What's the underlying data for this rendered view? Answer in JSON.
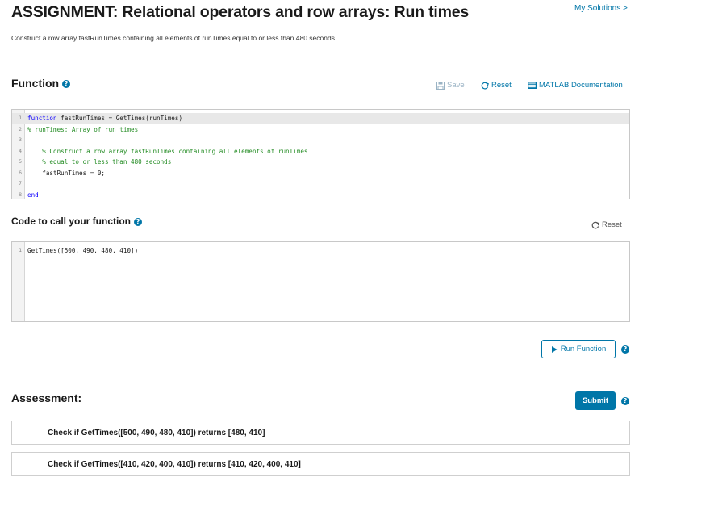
{
  "header": {
    "title": "ASSIGNMENT: Relational operators and row arrays: Run times",
    "my_solutions": "My Solutions >",
    "description": "Construct a row array fastRunTimes containing all elements of runTimes equal to or less than 480 seconds."
  },
  "function_section": {
    "title": "Function",
    "save_label": "Save",
    "reset_label": "Reset",
    "doc_label": "MATLAB Documentation",
    "lines": [
      {
        "num": "1",
        "parts": [
          {
            "t": "function",
            "c": "kw"
          },
          {
            "t": " fastRunTimes = GetTimes(runTimes)",
            "c": "tx"
          }
        ]
      },
      {
        "num": "2",
        "parts": [
          {
            "t": "% runTimes: Array of run times",
            "c": "cm"
          }
        ]
      },
      {
        "num": "3",
        "parts": []
      },
      {
        "num": "4",
        "parts": [
          {
            "t": "    % Construct a row array fastRunTimes containing all elements of runTimes",
            "c": "cm"
          }
        ]
      },
      {
        "num": "5",
        "parts": [
          {
            "t": "    % equal to or less than 480 seconds",
            "c": "cm"
          }
        ]
      },
      {
        "num": "6",
        "parts": [
          {
            "t": "    fastRunTimes = 0;",
            "c": "tx"
          }
        ]
      },
      {
        "num": "7",
        "parts": []
      },
      {
        "num": "8",
        "parts": [
          {
            "t": "end",
            "c": "kw"
          }
        ]
      }
    ]
  },
  "call_section": {
    "title": "Code to call your function",
    "reset_label": "Reset",
    "lines": [
      {
        "num": "1",
        "parts": [
          {
            "t": "GetTimes([500, 490, 480, 410])",
            "c": "tx"
          }
        ]
      }
    ]
  },
  "run_button": {
    "label": "Run Function"
  },
  "assessment": {
    "title": "Assessment:",
    "submit_label": "Submit",
    "tests": [
      "Check if GetTimes([500, 490, 480, 410]) returns [480, 410]",
      "Check if GetTimes([410, 420, 400, 410]) returns [410, 420, 400, 410]"
    ]
  },
  "icons": {
    "help": "help-icon",
    "save": "save-disk-icon",
    "reset": "reset-arrow-icon",
    "doc": "documentation-icon",
    "play": "play-icon"
  },
  "colors": {
    "accent": "#0076a8",
    "keyword": "#0e00ff",
    "comment": "#228b22"
  }
}
